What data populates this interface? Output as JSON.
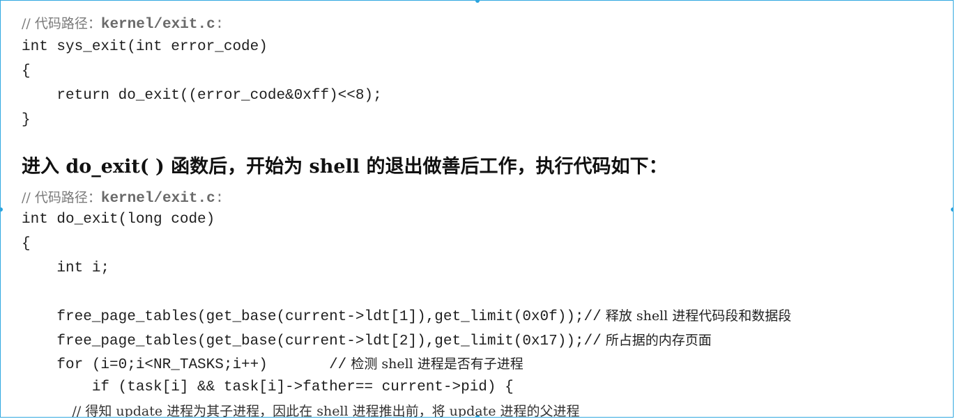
{
  "block1": {
    "comment_prefix": "// 代码路径：",
    "comment_path": "kernel/exit.c",
    "comment_suffix": ":",
    "lines": [
      "int sys_exit(int error_code)",
      "{",
      "    return do_exit((error_code&0xff)<<8);",
      "}"
    ]
  },
  "prose": "进入 do_exit( ) 函数后，开始为 shell 的退出做善后工作，执行代码如下：",
  "block2": {
    "comment_prefix": "// 代码路径：",
    "comment_path": "kernel/exit.c",
    "comment_suffix": ":",
    "line_signature": "int do_exit(long code)",
    "line_open": "{",
    "line_int_i": "    int i;",
    "line_free1_code": "    free_page_tables(get_base(current->ldt[1]),get_limit(0x0f));//",
    "line_free1_comment": " 释放 shell 进程代码段和数据段",
    "line_free2_code": "    free_page_tables(get_base(current->ldt[2]),get_limit(0x17));//",
    "line_free2_comment": " 所占据的内存页面",
    "line_for_code": "    for (i=0;i<NR_TASKS;i++)       //",
    "line_for_comment": " 检测 shell 进程是否有子进程",
    "line_if": "        if (task[i] && task[i]->father== current->pid) {",
    "line_last_comment": "            // 得知 update 进程为其子进程，因此在 shell 进程推出前，将 update 进程的父进程"
  }
}
